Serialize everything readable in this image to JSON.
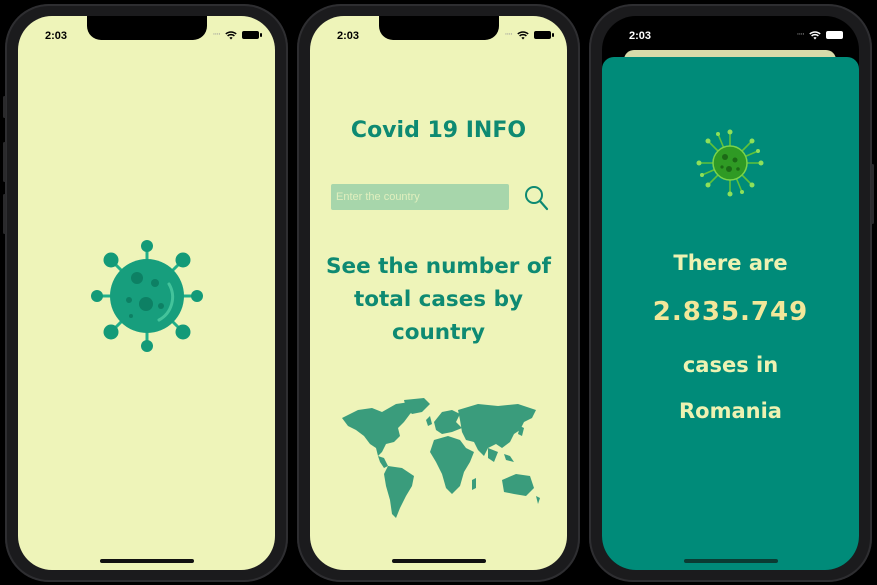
{
  "phones": [
    {
      "status": {
        "time": "2:03"
      }
    },
    {
      "status": {
        "time": "2:03"
      }
    },
    {
      "status": {
        "time": "2:03"
      }
    }
  ],
  "screen2": {
    "title": "Covid 19 INFO",
    "search": {
      "placeholder": "Enter the country",
      "value": ""
    },
    "headline": "See the number of total cases by country"
  },
  "screen3": {
    "line1": "There are",
    "count": "2.835.749",
    "line3": "cases in",
    "country": "Romania"
  },
  "colors": {
    "background_cream": "#eef4b9",
    "accent_teal": "#0e8a72",
    "sheet_teal": "#008b79",
    "count_yellow": "#f2e79a"
  },
  "icons": [
    "virus-icon",
    "search-icon",
    "world-map",
    "wifi-icon",
    "battery-icon"
  ]
}
